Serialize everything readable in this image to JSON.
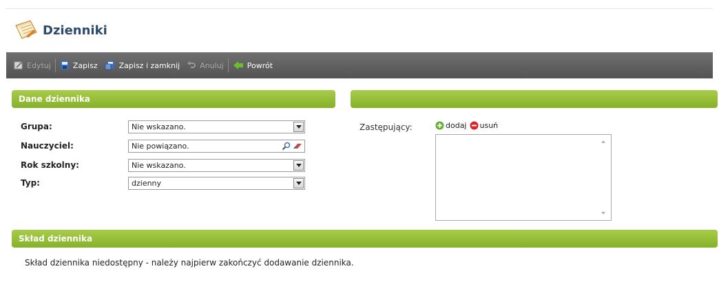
{
  "header": {
    "title": "Dzienniki"
  },
  "toolbar": {
    "items": [
      {
        "label": "Edytuj",
        "icon": "edit-icon",
        "disabled": true
      },
      {
        "label": "Zapisz",
        "icon": "save-icon",
        "disabled": false
      },
      {
        "label": "Zapisz i zamknij",
        "icon": "save-close-icon",
        "disabled": false
      },
      {
        "label": "Anuluj",
        "icon": "undo-icon",
        "disabled": true
      },
      {
        "label": "Powrót",
        "icon": "back-arrow-icon",
        "disabled": false
      }
    ]
  },
  "panels": {
    "dane": {
      "title": "Dane dziennika"
    },
    "right": {
      "title": ""
    },
    "sklad": {
      "title": "Skład dziennika",
      "message": "Skład dziennika niedostępny - należy najpierw zakończyć dodawanie dziennika."
    }
  },
  "form": {
    "grupa": {
      "label": "Grupa:",
      "value": "Nie wskazano."
    },
    "nauczyciel": {
      "label": "Nauczyciel:",
      "value": "Nie powiązano."
    },
    "rok": {
      "label": "Rok szkolny:",
      "value": "Nie wskazano."
    },
    "typ": {
      "label": "Typ:",
      "value": "dzienny"
    }
  },
  "zastepujacy": {
    "label": "Zastępujący:",
    "add_label": "dodaj",
    "remove_label": "usuń",
    "items": []
  },
  "colors": {
    "header_green": "#95bd36",
    "toolbar_gray": "#606060",
    "title_blue": "#2d4a6a"
  }
}
